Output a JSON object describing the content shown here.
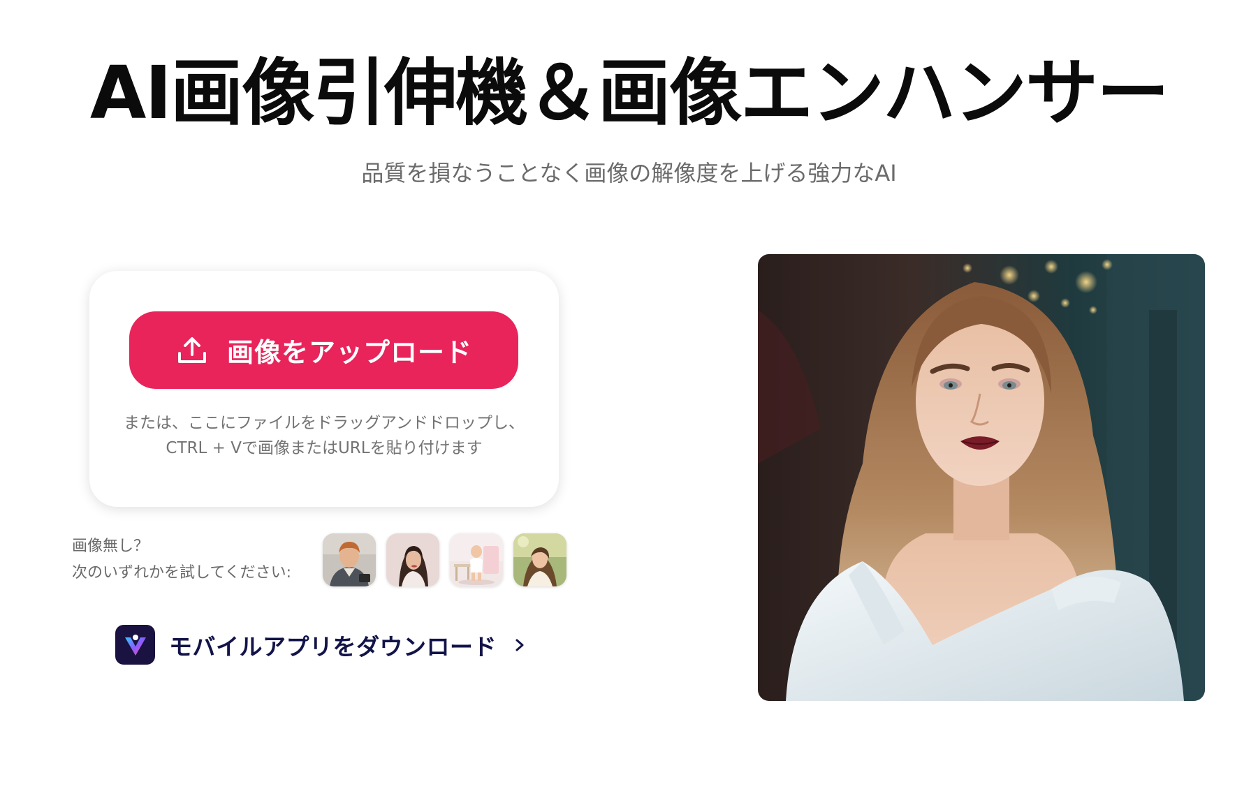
{
  "hero": {
    "title": "AI画像引伸機＆画像エンハンサー",
    "subtitle": "品質を損なうことなく画像の解像度を上げる強力なAI"
  },
  "upload": {
    "button_label": "画像をアップロード",
    "button_icon": "upload-icon",
    "hint_line1": "または、ここにファイルをドラッグアンドドロップし、",
    "hint_line2": "CTRL + Vで画像またはURLを貼り付けます",
    "accent_color": "#e8245a"
  },
  "samples": {
    "prompt_line1": "画像無し？",
    "prompt_line2": "次のいずれかを試してください:",
    "items": [
      {
        "name": "sample-boy-denim-jacket"
      },
      {
        "name": "sample-woman-dark-hair"
      },
      {
        "name": "sample-baby-walking"
      },
      {
        "name": "sample-woman-outdoors"
      }
    ]
  },
  "app_download": {
    "label": "モバイルアプリをダウンロード",
    "logo_icon": "app-logo-icon",
    "chevron_icon": "chevron-right-icon",
    "text_color": "#121348"
  },
  "preview": {
    "subject": "portrait-woman-white-shirt"
  }
}
